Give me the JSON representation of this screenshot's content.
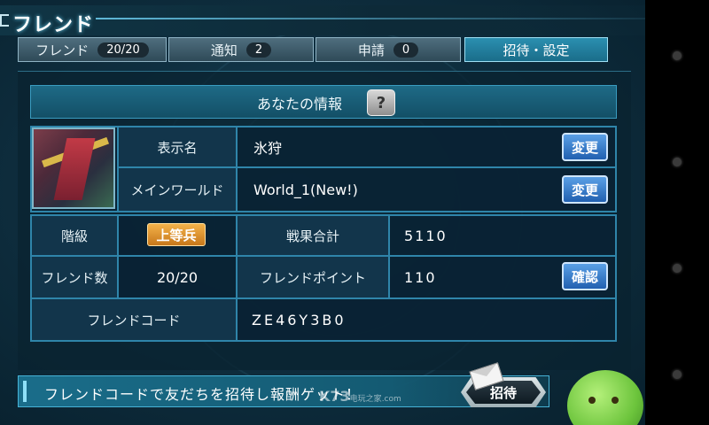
{
  "title": "フレンド",
  "tabs": [
    {
      "label": "フレンド",
      "badge": "20/20"
    },
    {
      "label": "通知",
      "badge": "2"
    },
    {
      "label": "申請",
      "badge": "0"
    },
    {
      "label": "招待・設定",
      "badge": ""
    }
  ],
  "info": {
    "header": "あなたの情報",
    "help_label": "?",
    "display_name_label": "表示名",
    "display_name_value": "氷狩",
    "main_world_label": "メインワールド",
    "main_world_value": "World_1(New!)",
    "change_label": "変更",
    "rank_label": "階級",
    "rank_value": "上等兵",
    "battle_total_label": "戦果合計",
    "battle_total_value": "5110",
    "friend_count_label": "フレンド数",
    "friend_count_value": "20/20",
    "friend_points_label": "フレンドポイント",
    "friend_points_value": "110",
    "confirm_label": "確認",
    "friend_code_label": "フレンドコード",
    "friend_code_value": "ZE46Y3B0"
  },
  "banner": {
    "text": "フレンドコードで友だちを招待し報酬ゲット！",
    "invite_label": "招待"
  },
  "watermark": {
    "brand": "K73",
    "sub": "电玩之家",
    "domain": ".com"
  },
  "icons": [
    "help-icon",
    "envelope-icon",
    "haro-mascot-icon"
  ],
  "colors": {
    "accent": "#2f85aa",
    "active_tab": "#2b8fb0",
    "rank_badge": "#e39a30",
    "button_blue": "#2160b0"
  }
}
